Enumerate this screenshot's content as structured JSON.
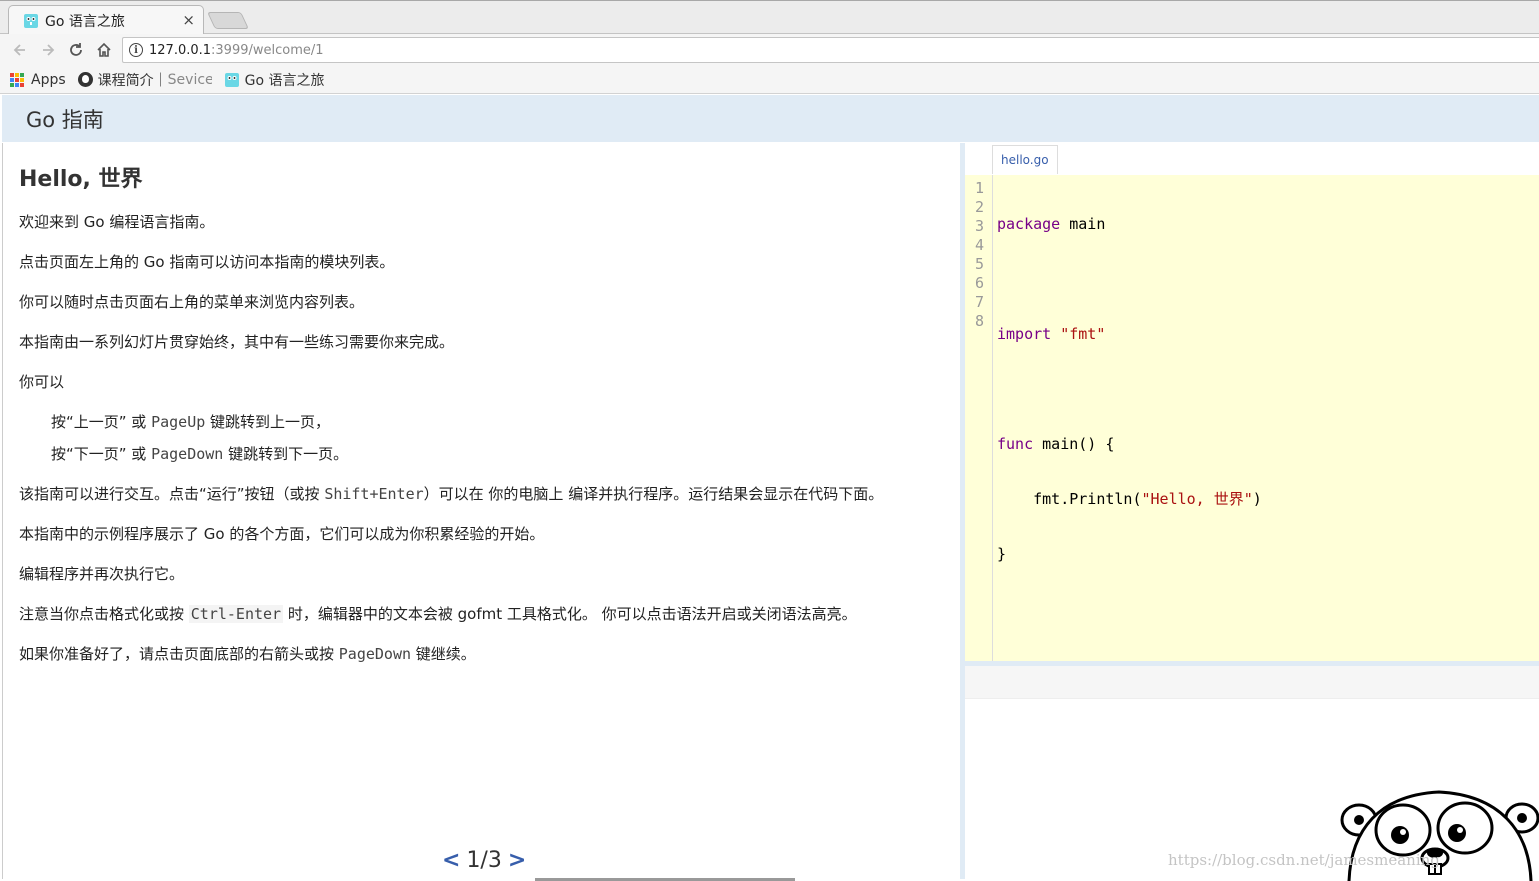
{
  "browser": {
    "tab_title": "Go 语言之旅",
    "tab_close": "×",
    "url_host": "127.0.0.1",
    "url_path": ":3999/welcome/1",
    "bookmarks": {
      "apps": "Apps",
      "course": "课程简介｜",
      "course_tail": "Sevice",
      "tour": "Go 语言之旅"
    }
  },
  "header": {
    "title": "Go 指南"
  },
  "slide": {
    "title": "Hello, 世界",
    "p1": "欢迎来到 Go 编程语言指南。",
    "p2": "点击页面左上角的 Go 指南可以访问本指南的模块列表。",
    "p3": "你可以随时点击页面右上角的菜单来浏览内容列表。",
    "p4": "本指南由一系列幻灯片贯穿始终，其中有一些练习需要你来完成。",
    "p5": "你可以",
    "item1_a": "按“上一页” 或 ",
    "item1_key": "PageUp",
    "item1_b": " 键跳转到上一页，",
    "item2_a": "按“下一页” 或 ",
    "item2_key": "PageDown",
    "item2_b": " 键跳转到下一页。",
    "p6_a": "该指南可以进行交互。点击“运行”按钮（或按 ",
    "p6_key": "Shift+Enter",
    "p6_b": "）可以在 你的电脑上 编译并执行程序。运行结果会显示在代码下面。",
    "p7": "本指南中的示例程序展示了 Go 的各个方面，它们可以成为你积累经验的开始。",
    "p8": "编辑程序并再次执行它。",
    "p9_a": "注意当你点击格式化或按 ",
    "p9_key": "Ctrl-Enter",
    "p9_b": " 时，编辑器中的文本会被 gofmt 工具格式化。 你可以点击语法开启或关闭语法高亮。",
    "p10_a": "如果你准备好了，请点击页面底部的右箭头或按 ",
    "p10_key": "PageDown",
    "p10_b": " 键继续。"
  },
  "pager": {
    "prev": "<",
    "current": "1/3",
    "next": ">"
  },
  "editor": {
    "file_tab": "hello.go",
    "line_numbers": [
      "1",
      "2",
      "3",
      "4",
      "5",
      "6",
      "7",
      "8"
    ],
    "l1_kw": "package",
    "l1_rest": " main",
    "l3_kw": "import",
    "l3_str": " \"fmt\"",
    "l5_kw": "func",
    "l5_rest": " main() {",
    "l6_a": "    fmt.Println(",
    "l6_str": "\"Hello, 世界\"",
    "l6_b": ")",
    "l7": "}"
  },
  "watermark": "https://blog.csdn.net/jamesmeaning",
  "colors": {
    "header_bg": "#e0ebf5",
    "editor_bg": "#ffffd8",
    "link_blue": "#375eab",
    "keyword": "#770088",
    "string": "#aa1111"
  }
}
